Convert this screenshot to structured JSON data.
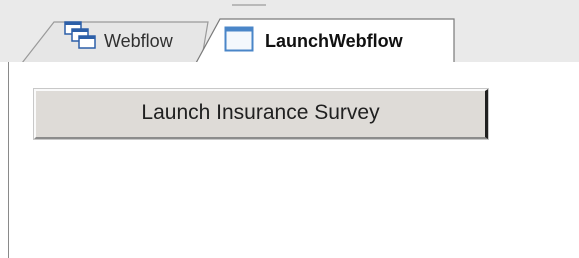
{
  "tabs": [
    {
      "label": "Webflow",
      "icon": "window-stack-icon",
      "active": false
    },
    {
      "label": "LaunchWebflow",
      "icon": "window-icon",
      "active": true
    }
  ],
  "content": {
    "button_label": "Launch Insurance Survey"
  },
  "colors": {
    "tabstrip_bg": "#eaeaea",
    "tab_border": "#8a8a8a",
    "button_face": "#dedbd7",
    "icon_blue": "#4a86c8"
  }
}
